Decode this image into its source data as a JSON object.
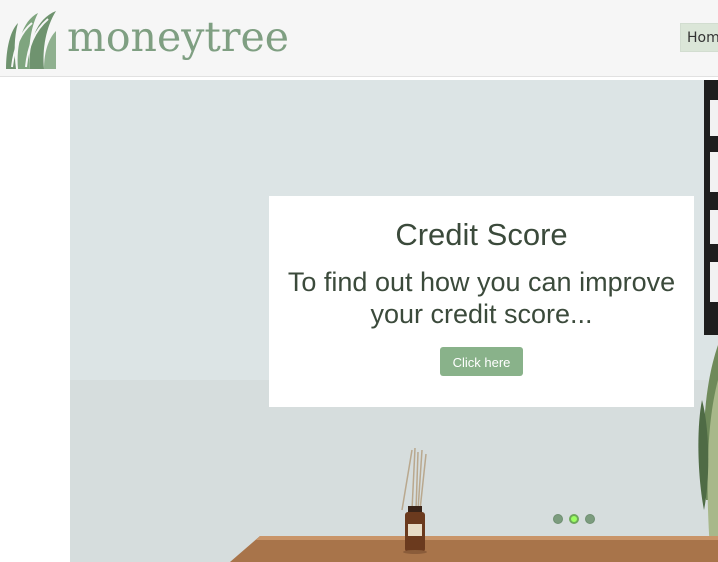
{
  "brand": {
    "name": "moneytree",
    "logo_icon": "moneytree-m-leaf-logo",
    "accent_color": "#7f9f82"
  },
  "nav": {
    "home_label": "Home"
  },
  "slider": {
    "caption_title": "Credit Score",
    "caption_text": "To find out how you can improve your credit score...",
    "button_label": "Click here",
    "slide_count": 3,
    "active_slide": 2,
    "button_color": "#89b28a",
    "active_dot_color": "#9bff62"
  }
}
